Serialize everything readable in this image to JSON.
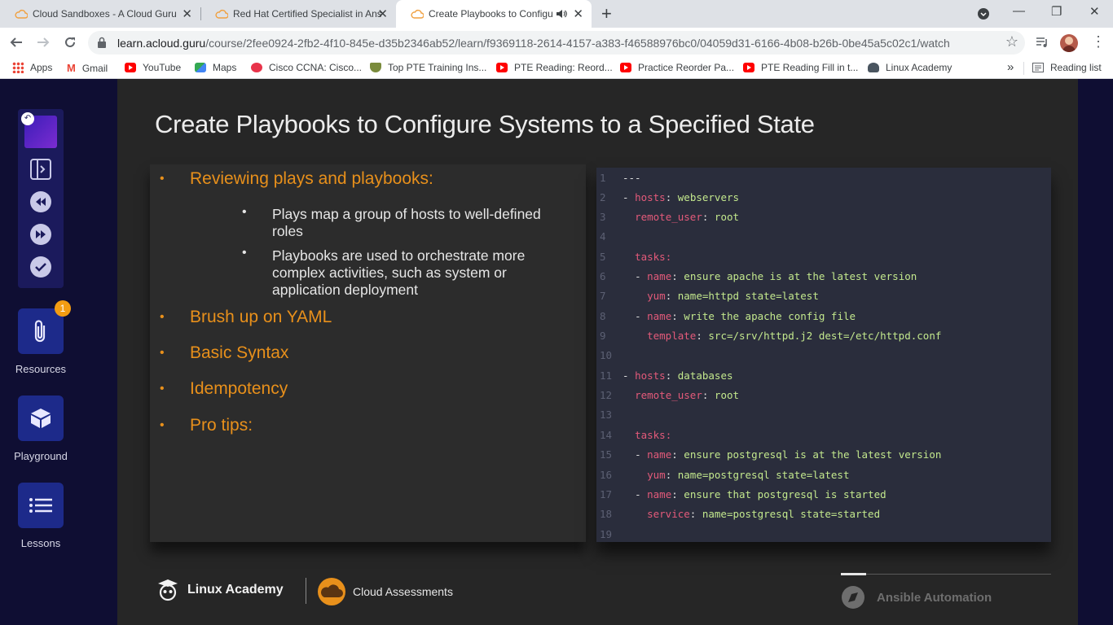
{
  "browser": {
    "tabs": [
      {
        "title": "Cloud Sandboxes - A Cloud Guru",
        "close": "✕"
      },
      {
        "title": "Red Hat Certified Specialist in Ansible",
        "close": "✕"
      },
      {
        "title": "Create Playbooks to Configure",
        "close": "✕"
      }
    ],
    "new_tab": "+",
    "window": {
      "minimize": "—",
      "restore": "❐",
      "close": "✕"
    },
    "url_host": "learn.acloud.guru",
    "url_path": "/course/2fee0924-2fb2-4f10-845e-d35b2346ab52/learn/f9369118-2614-4157-a383-f46588976bc0/04059d31-6166-4b08-b26b-0be45a5c02c1/watch",
    "bookmarks": [
      "Apps",
      "Gmail",
      "YouTube",
      "Maps",
      "Cisco CCNA: Cisco...",
      "Top PTE Training Ins...",
      "PTE Reading: Reord...",
      "Practice Reorder Pa...",
      "PTE Reading Fill in t...",
      "Linux Academy"
    ],
    "more": "»",
    "reading_list": "Reading list"
  },
  "sidebar": {
    "resources_label": "Resources",
    "resources_badge": "1",
    "playground_label": "Playground",
    "lessons_label": "Lessons"
  },
  "slide": {
    "title": "Create Playbooks to Configure Systems to a Specified State",
    "bullets": [
      "Reviewing plays and playbooks:",
      "Brush up on YAML",
      "Basic Syntax",
      "Idempotency",
      "Pro tips:"
    ],
    "sub_bullets": [
      "Plays map a group of hosts to well-defined roles",
      "Playbooks are used to orchestrate more complex activities, such as system or application deployment"
    ],
    "bullet_glyph": "•",
    "code": {
      "line_numbers": [
        "1",
        "2",
        "3",
        "4",
        "5",
        "6",
        "7",
        "8",
        "9",
        "10",
        "11",
        "12",
        "13",
        "14",
        "15",
        "16",
        "17",
        "18",
        "19"
      ],
      "doc_start": "---",
      "dash": "- ",
      "colon": ": ",
      "k_hosts": "hosts",
      "v_webservers": "webservers",
      "v_databases": "databases",
      "k_remote_user": "remote_user",
      "v_root": "root",
      "k_tasks": "tasks:",
      "k_name": "name",
      "k_yum": "yum",
      "k_template": "template",
      "k_service": "service",
      "v_l6": "ensure apache is at the latest version",
      "v_l7": "name=httpd state=latest",
      "v_l8": "write the apache config file",
      "v_l9": "src=/srv/httpd.j2 dest=/etc/httpd.conf",
      "v_l15": "ensure postgresql is at the latest version",
      "v_l16": "name=postgresql state=latest",
      "v_l17": "ensure that postgresql is started",
      "v_l18": "name=postgresql state=started"
    },
    "footer": {
      "linux_academy": "Linux Academy",
      "cloud_assessments": "Cloud Assessments",
      "ansible": "Ansible Automation",
      "progress_fraction": 0.12
    }
  },
  "colors": {
    "accent_orange": "#e8901b",
    "yaml_key": "#e45a7a",
    "yaml_value": "#c3e88d",
    "rail_bg": "#0f0e33"
  }
}
